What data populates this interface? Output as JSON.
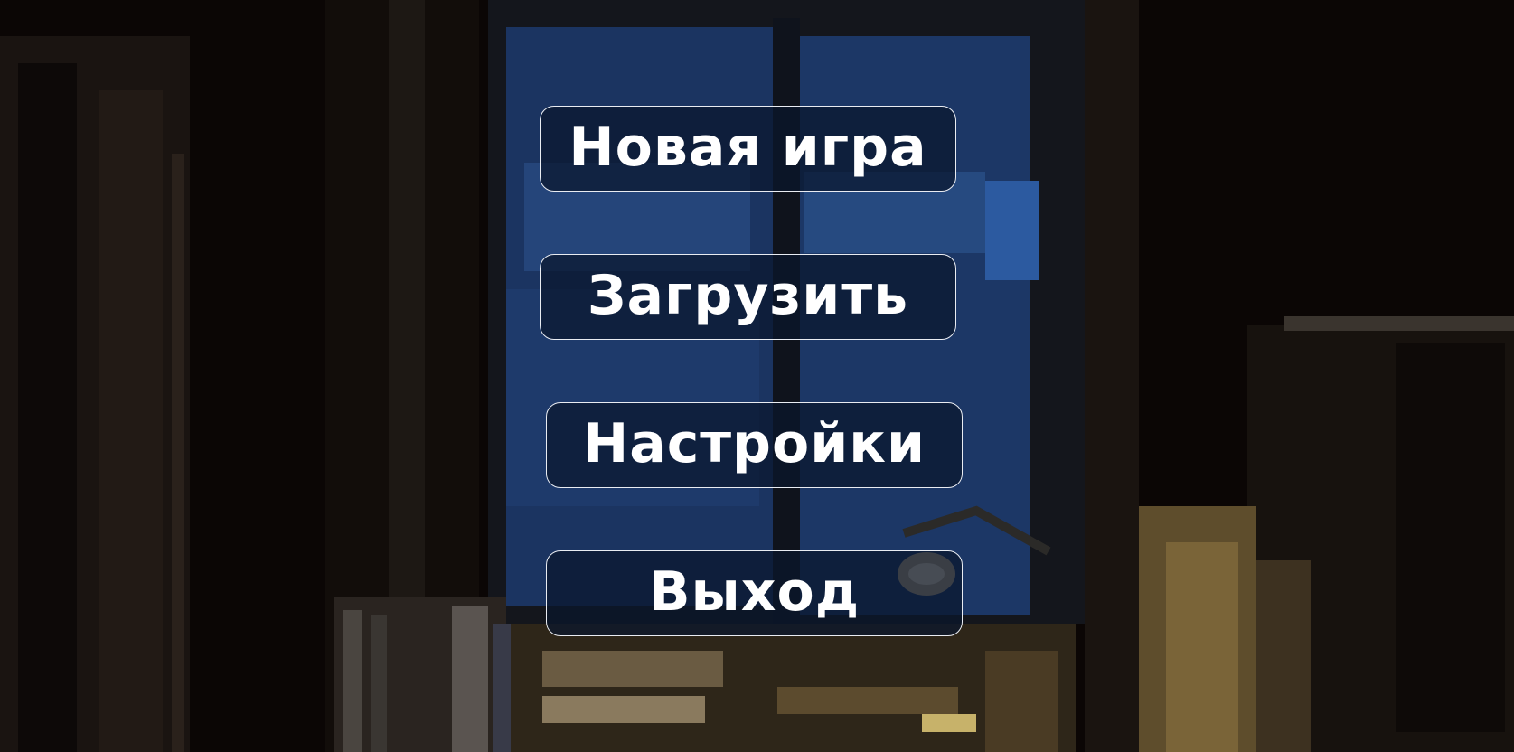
{
  "menu": {
    "new_game": "Новая игра",
    "load": "Загрузить",
    "settings": "Настройки",
    "exit": "Выход"
  },
  "colors": {
    "background": "#0b0605",
    "window_blue": "#1c3560",
    "button_fill": "#0a162c",
    "button_border": "#e9ecf2",
    "text": "#ffffff"
  }
}
